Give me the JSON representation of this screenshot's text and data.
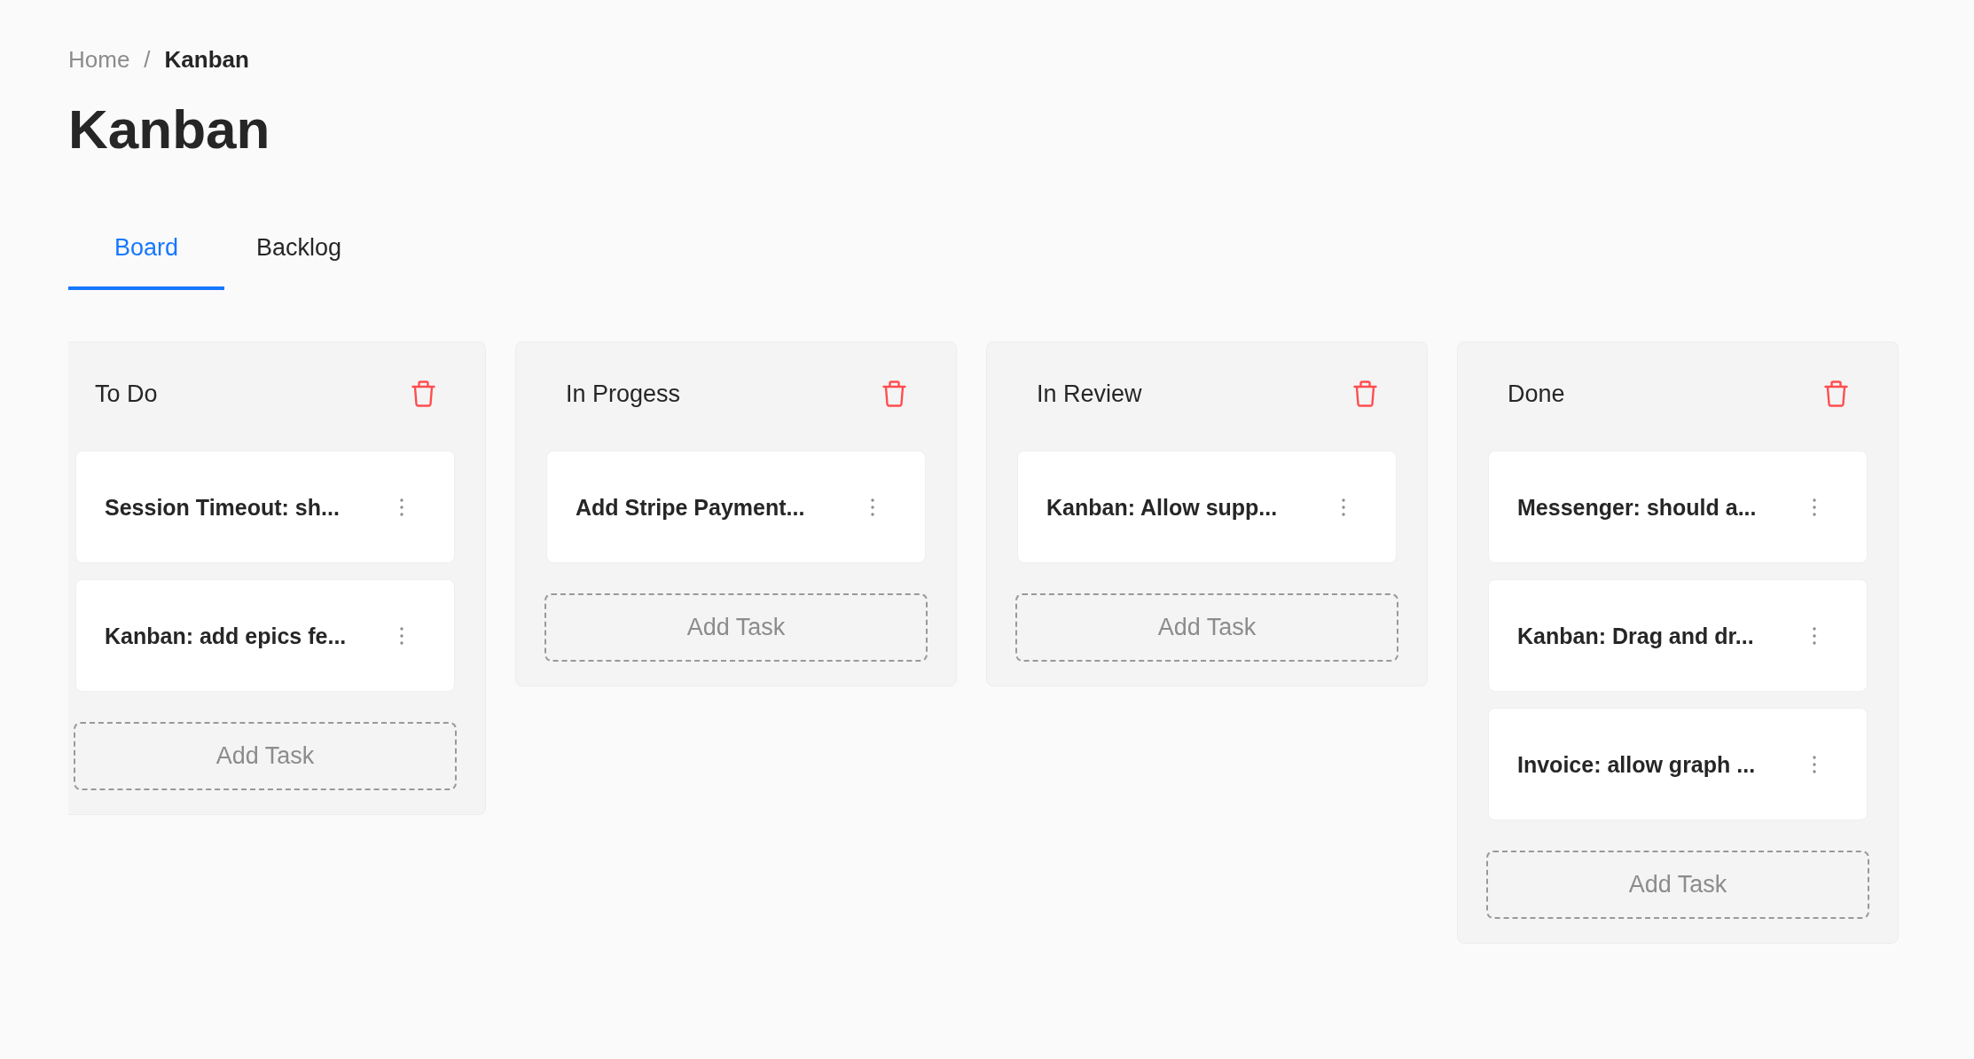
{
  "breadcrumb": {
    "items": [
      {
        "label": "Home",
        "current": false
      },
      {
        "label": "Kanban",
        "current": true
      }
    ],
    "separator": "/"
  },
  "title": "Kanban",
  "tabs": [
    {
      "label": "Board",
      "selected": true
    },
    {
      "label": "Backlog",
      "selected": false
    }
  ],
  "columns": [
    {
      "title": "To Do",
      "tasks": [
        "Session Timeout: sh...",
        "Kanban: add epics fe..."
      ],
      "add_button": "Add Task"
    },
    {
      "title": "In Progess",
      "tasks": [
        "Add Stripe Payment..."
      ],
      "add_button": "Add Task"
    },
    {
      "title": "In Review",
      "tasks": [
        "Kanban: Allow supp..."
      ],
      "add_button": "Add Task"
    },
    {
      "title": "Done",
      "tasks": [
        "Messenger: should a...",
        "Kanban: Drag and dr...",
        "Invoice: allow graph ..."
      ],
      "add_button": "Add Task"
    }
  ]
}
